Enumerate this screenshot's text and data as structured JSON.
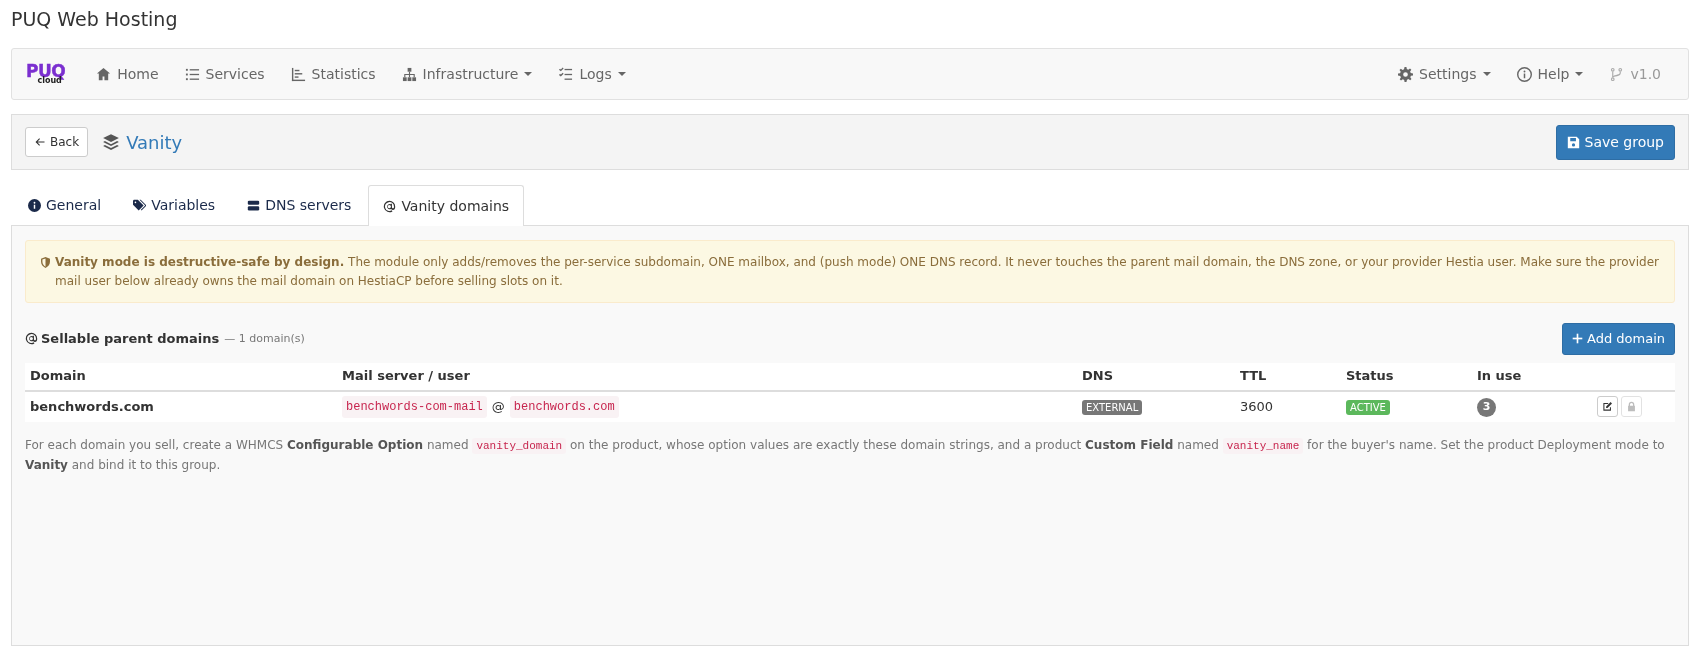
{
  "page_title": "PUQ Web Hosting",
  "brand": {
    "main": "PUQ",
    "sub": "cloud"
  },
  "nav_left": [
    {
      "label": "Home",
      "dropdown": false
    },
    {
      "label": "Services",
      "dropdown": false
    },
    {
      "label": "Statistics",
      "dropdown": false
    },
    {
      "label": "Infrastructure",
      "dropdown": true
    },
    {
      "label": "Logs",
      "dropdown": true
    }
  ],
  "nav_right": [
    {
      "label": "Settings",
      "dropdown": true,
      "disabled": false
    },
    {
      "label": "Help",
      "dropdown": true,
      "disabled": false
    },
    {
      "label": "v1.0",
      "dropdown": false,
      "disabled": true
    }
  ],
  "header": {
    "back": "Back",
    "title": "Vanity",
    "save": "Save group"
  },
  "tabs": [
    {
      "label": "General",
      "selected": false
    },
    {
      "label": "Variables",
      "selected": false
    },
    {
      "label": "DNS servers",
      "selected": false
    },
    {
      "label": "Vanity domains",
      "selected": true
    }
  ],
  "alert": "**Vanity mode is destructive-safe by design.** The module only adds/removes the per-service subdomain, ONE mailbox, and (push mode) ONE DNS record. It never touches the parent mail domain, the DNS zone, or your provider Hestia user. Make sure the provider mail user below already owns the mail domain on HestiaCP before selling slots on it.",
  "section": {
    "title": "Sellable parent domains",
    "count": "— 1 domain(s)",
    "add": "Add domain"
  },
  "table": {
    "columns": [
      "Domain",
      "Mail server / user",
      "DNS",
      "TTL",
      "Status",
      "In use"
    ],
    "rows": [
      {
        "domain": "benchwords.com",
        "mail_user": "benchwords-com-mail",
        "at": "@",
        "mail_domain": "benchwords.com",
        "dns": "EXTERNAL",
        "ttl": "3600",
        "status": "ACTIVE",
        "color": "#5cb85c",
        "in_use": "3",
        "actions": [
          {
            "kind": "edit",
            "disabled": false
          },
          {
            "kind": "lock",
            "disabled": true
          }
        ]
      }
    ]
  },
  "note": [
    {
      "kind": "text",
      "text": "For each domain you sell, create a WHMCS **Configurable Option** named "
    },
    {
      "kind": "code",
      "text": "vanity_domain"
    },
    {
      "kind": "text",
      "text": " on the product, whose option values are exactly these domain strings, and a product **Custom Field** named "
    },
    {
      "kind": "code",
      "text": "vanity_name"
    },
    {
      "kind": "text",
      "text": " for the buyer's name. Set the product Deployment mode to **Vanity** and bind it to this group."
    }
  ]
}
